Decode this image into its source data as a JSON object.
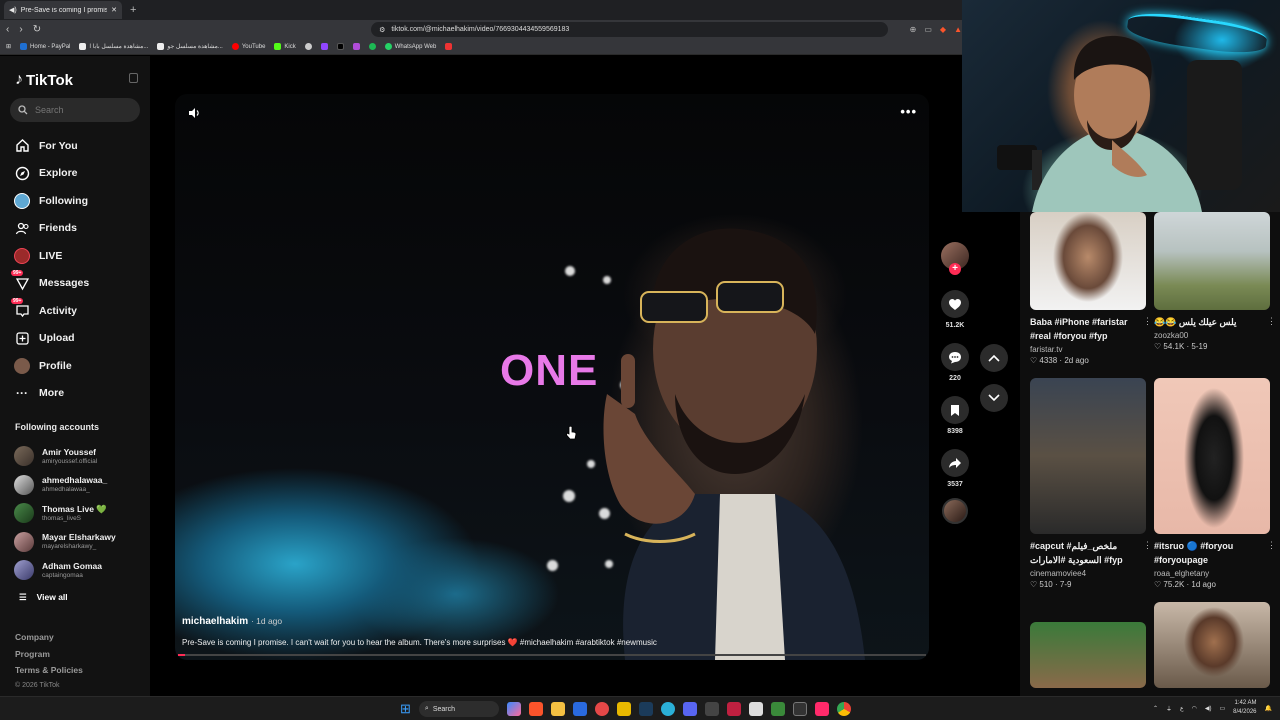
{
  "browser": {
    "tab_title": "Pre-Save is coming I promise",
    "new_tab_label": "+",
    "url": "tiktok.com/@michaelhakim/video/7669304434559569183",
    "bookmarks": [
      "Home - PayPal",
      "مشاهدة مسلسل بابا ا...",
      "مشاهدة مسلسل جو...",
      "YouTube",
      "Kick",
      "WhatsApp Web"
    ]
  },
  "sidebar": {
    "logo": "TikTok",
    "search_placeholder": "Search",
    "nav": [
      {
        "label": "For You",
        "icon": "home-icon"
      },
      {
        "label": "Explore",
        "icon": "compass-icon"
      },
      {
        "label": "Following",
        "icon": "following-icon"
      },
      {
        "label": "Friends",
        "icon": "friends-icon"
      },
      {
        "label": "LIVE",
        "icon": "live-icon"
      },
      {
        "label": "Messages",
        "icon": "messages-icon",
        "badge": "99+"
      },
      {
        "label": "Activity",
        "icon": "activity-icon",
        "badge": "99+"
      },
      {
        "label": "Upload",
        "icon": "upload-icon"
      },
      {
        "label": "Profile",
        "icon": "profile-icon"
      },
      {
        "label": "More",
        "icon": "more-dots-icon"
      }
    ],
    "following_title": "Following accounts",
    "accounts": [
      {
        "name": "Amir Youssef",
        "handle": "amiryoussef.official"
      },
      {
        "name": "ahmedhalawaa_",
        "handle": "ahmedhalawaa_"
      },
      {
        "name": "Thomas Live 💚",
        "handle": "thomas_liveS"
      },
      {
        "name": "Mayar Elsharkawy",
        "handle": "mayarelsharkawy_"
      },
      {
        "name": "Adham Gomaa",
        "handle": "captaingomaa"
      }
    ],
    "view_all": "View all",
    "footer": [
      "Company",
      "Program",
      "Terms & Policies"
    ],
    "copyright": "© 2026 TikTok"
  },
  "video": {
    "overlay_word": "ONE",
    "author": "michaelhakim",
    "ago": "· 1d ago",
    "caption": "Pre-Save is coming I promise. I can't wait for you to hear the album. There's more surprises ❤️ #michaelhakim #arabtiktok #newmusic",
    "progress": 0.01
  },
  "actions": {
    "likes": "51.2K",
    "comments": "220",
    "saves": "8398",
    "shares": "3537"
  },
  "recommended": [
    {
      "title": "Baba #iPhone #faristar #real #foryou #fyp",
      "author": "faristar.tv",
      "likes": "4338",
      "date": "2d ago"
    },
    {
      "title": "يلس عيلك يلس 😂😂",
      "author": "zoozka00",
      "likes": "54.1K",
      "date": "5-19"
    },
    {
      "title": "#capcut ملخص_فيلم# السعودية #الامارات #fyp",
      "author": "cinemamoviee4",
      "likes": "510",
      "date": "7-9"
    },
    {
      "title": "#itsruo 🔵 #foryou #foryoupage",
      "author": "roaa_elghetany",
      "likes": "75.2K",
      "date": "1d ago"
    },
    {
      "title": "",
      "author": "",
      "likes": "",
      "date": ""
    },
    {
      "title": "",
      "author": "",
      "likes": "",
      "date": ""
    }
  ],
  "taskbar": {
    "search": "Search",
    "time": "1:42 AM",
    "date": "8/4/2026"
  }
}
